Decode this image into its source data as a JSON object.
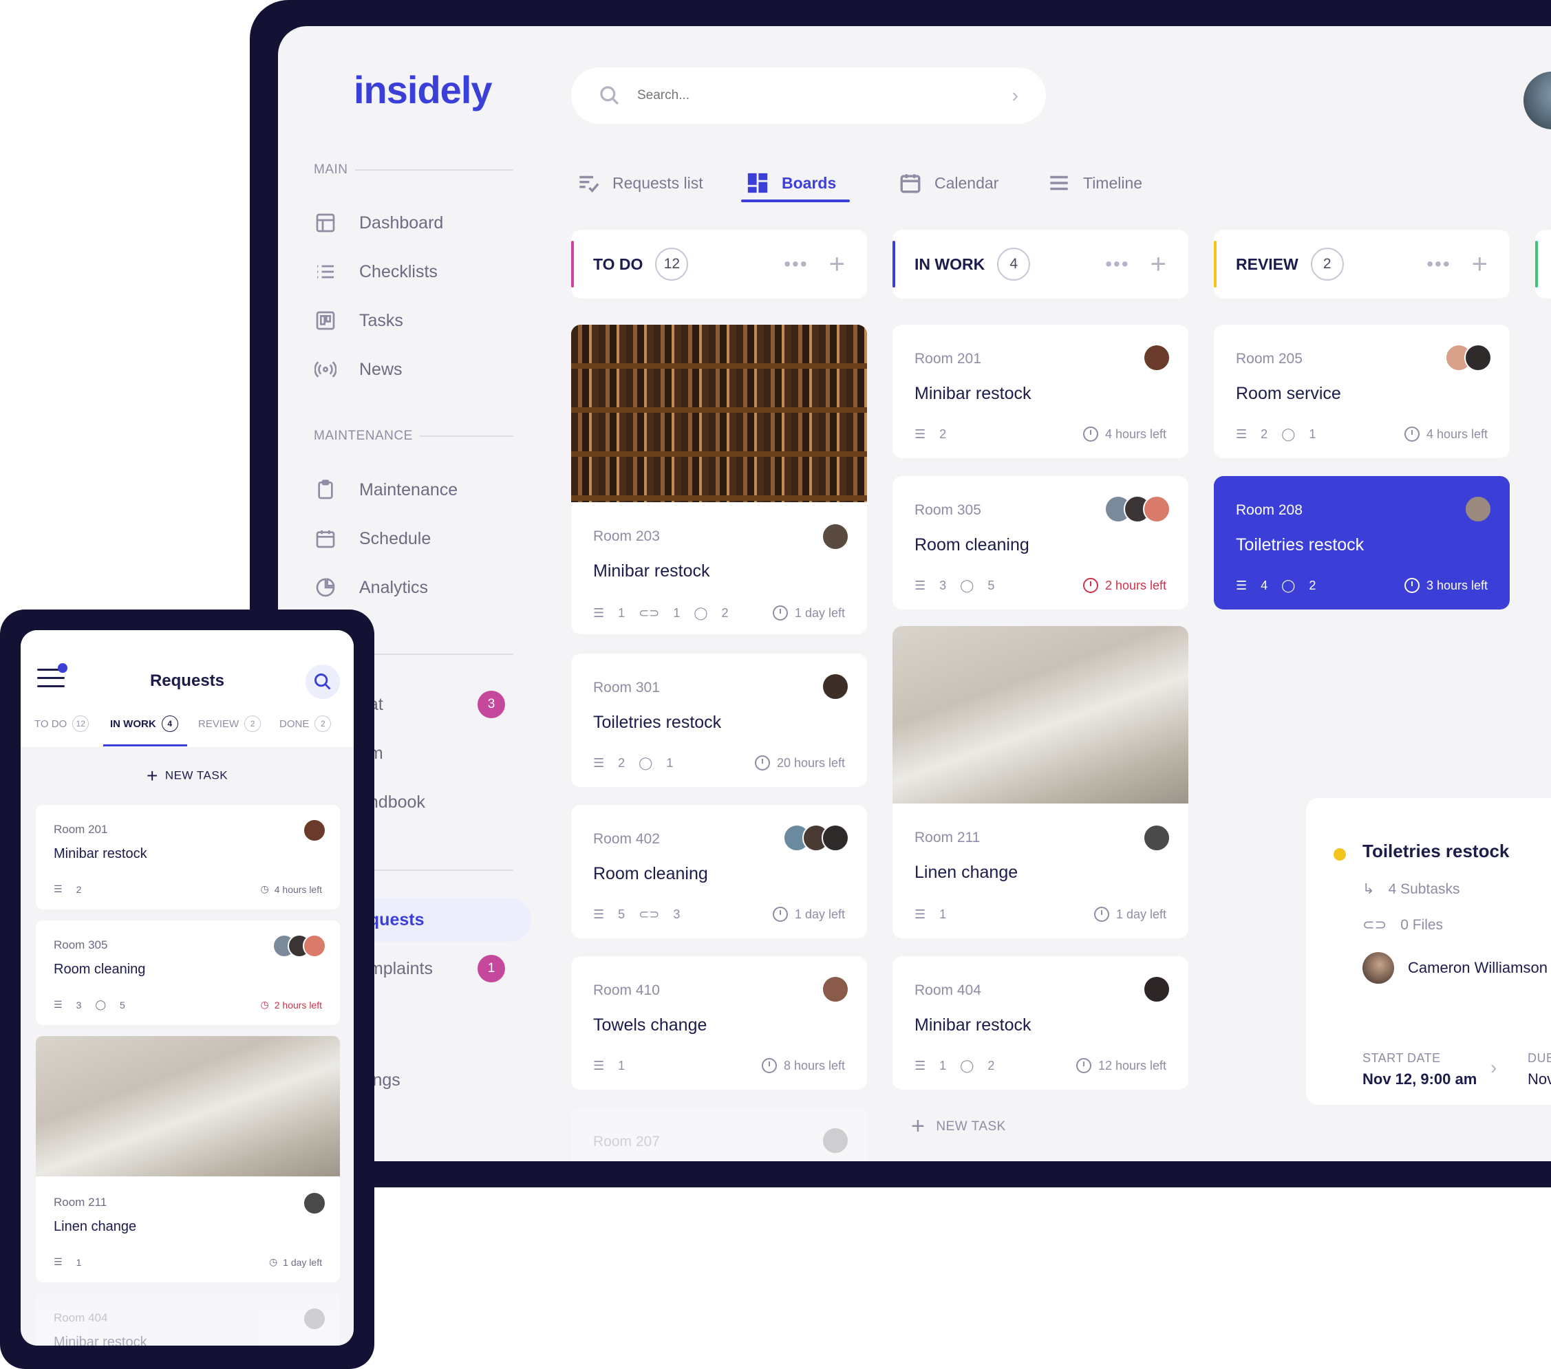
{
  "brand": {
    "logo": "insidely"
  },
  "search": {
    "placeholder": "Search..."
  },
  "sidebar": {
    "main_label": "MAIN",
    "main_items": [
      {
        "label": "Dashboard",
        "icon": "layout-icon"
      },
      {
        "label": "Checklists",
        "icon": "list-icon"
      },
      {
        "label": "Tasks",
        "icon": "kanban-icon"
      },
      {
        "label": "News",
        "icon": "broadcast-icon"
      }
    ],
    "maintenance_label": "MAINTENANCE",
    "maintenance_items": [
      {
        "label": "Maintenance",
        "icon": "clipboard-icon"
      },
      {
        "label": "Schedule",
        "icon": "calendar-icon"
      },
      {
        "label": "Analytics",
        "icon": "pie-chart-icon"
      }
    ],
    "partial_items": [
      {
        "label": "hat",
        "badge": "3"
      },
      {
        "label": "am"
      },
      {
        "label": "andbook"
      },
      {
        "label": "equests",
        "active": true
      },
      {
        "label": "omplaints",
        "badge": "1"
      },
      {
        "label": "ttings"
      }
    ]
  },
  "views": {
    "tabs": [
      {
        "label": "Requests list",
        "icon": "list-check-icon"
      },
      {
        "label": "Boards",
        "icon": "boards-icon",
        "active": true
      },
      {
        "label": "Calendar",
        "icon": "calendar-icon"
      },
      {
        "label": "Timeline",
        "icon": "timeline-icon"
      }
    ]
  },
  "board": {
    "columns": [
      {
        "title": "TO DO",
        "count": "12",
        "color": "#c6489c",
        "cards": [
          {
            "room": "Room 203",
            "task": "Minibar restock",
            "checklist": "1",
            "attachments": "1",
            "comments": "2",
            "time": "1 day left",
            "photo": "bottles"
          },
          {
            "room": "Room 301",
            "task": "Toiletries restock",
            "checklist": "2",
            "comments": "1",
            "time": "20 hours left"
          },
          {
            "room": "Room 402",
            "task": "Room cleaning",
            "checklist": "5",
            "attachments": "3",
            "time": "1 day left"
          },
          {
            "room": "Room 410",
            "task": "Towels change",
            "checklist": "1",
            "time": "8 hours left"
          },
          {
            "room": "Room 207"
          }
        ]
      },
      {
        "title": "IN WORK",
        "count": "4",
        "color": "#3b3fd8",
        "cards": [
          {
            "room": "Room 201",
            "task": "Minibar restock",
            "checklist": "2",
            "time": "4 hours left"
          },
          {
            "room": "Room 305",
            "task": "Room cleaning",
            "checklist": "3",
            "comments": "5",
            "time": "2 hours left",
            "urgent": true
          },
          {
            "room": "Room 211",
            "task": "Linen change",
            "checklist": "1",
            "time": "1 day left",
            "photo": "bed"
          },
          {
            "room": "Room 404",
            "task": "Minibar restock",
            "checklist": "1",
            "comments": "2",
            "time": "12 hours left"
          }
        ],
        "new_task": "NEW TASK"
      },
      {
        "title": "REVIEW",
        "count": "2",
        "color": "#f3c51b",
        "cards": [
          {
            "room": "Room 205",
            "task": "Room service",
            "checklist": "2",
            "comments": "1",
            "time": "4 hours left"
          },
          {
            "room": "Room 208",
            "task": "Toiletries restock",
            "checklist": "4",
            "comments": "2",
            "time": "3 hours left",
            "selected": true
          }
        ]
      }
    ]
  },
  "detail": {
    "title": "Toiletries restock",
    "subtasks": "4 Subtasks",
    "files": "0 Files",
    "assignee": "Cameron Williamson",
    "start_label": "START DATE",
    "start_value": "Nov 12, 9:00 am",
    "due_label": "DUE",
    "due_value": "Nov"
  },
  "phone": {
    "title": "Requests",
    "tabs": [
      {
        "label": "TO DO",
        "count": "12"
      },
      {
        "label": "IN WORK",
        "count": "4",
        "active": true
      },
      {
        "label": "REVIEW",
        "count": "2"
      },
      {
        "label": "DONE",
        "count": "2"
      }
    ],
    "new_task": "NEW TASK",
    "cards": [
      {
        "room": "Room 201",
        "task": "Minibar restock",
        "checklist": "2",
        "time": "4 hours left"
      },
      {
        "room": "Room 305",
        "task": "Room cleaning",
        "checklist": "3",
        "comments": "5",
        "time": "2 hours left",
        "urgent": true
      },
      {
        "room": "Room 211",
        "task": "Linen change",
        "checklist": "1",
        "time": "1 day left",
        "photo": "bed"
      },
      {
        "room": "Room 404",
        "task": "Minibar restock"
      }
    ]
  }
}
